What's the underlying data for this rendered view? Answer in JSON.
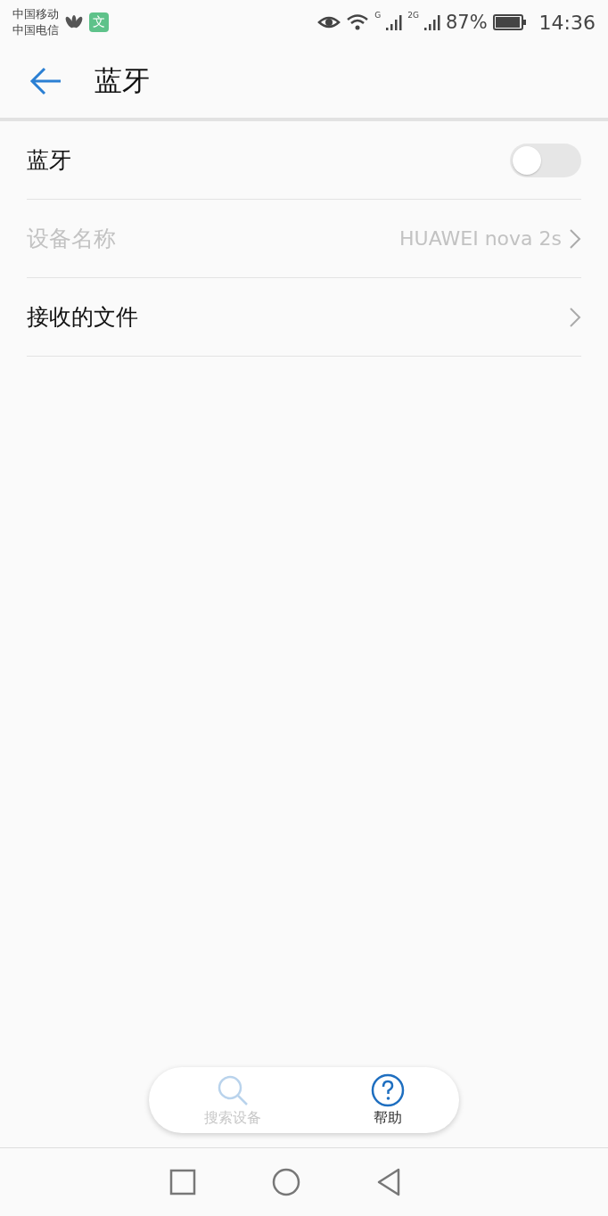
{
  "status_bar": {
    "carriers": [
      "中国移动",
      "中国电信"
    ],
    "app_badge": "文",
    "signal_labels": [
      "G",
      "2G"
    ],
    "battery": "87%",
    "time": "14:36"
  },
  "header": {
    "title": "蓝牙"
  },
  "rows": [
    {
      "kind": "toggle",
      "label": "蓝牙",
      "on": false,
      "disabled": false
    },
    {
      "kind": "value",
      "label": "设备名称",
      "value": "HUAWEI nova 2s",
      "disabled": true
    },
    {
      "kind": "link",
      "label": "接收的文件",
      "disabled": false
    }
  ],
  "actions": [
    {
      "kind": "search",
      "label": "搜索设备",
      "disabled": true
    },
    {
      "kind": "help",
      "label": "帮助",
      "disabled": false
    }
  ]
}
